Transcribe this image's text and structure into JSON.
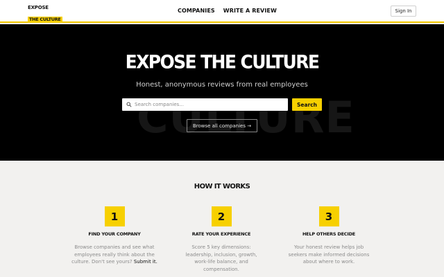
{
  "header": {
    "logo_line1": "EXPOSE",
    "logo_line2": "THE CULTURE",
    "nav": [
      "COMPANIES",
      "WRITE A REVIEW"
    ],
    "signin_label": "Sign In"
  },
  "hero": {
    "title": "EXPOSE THE CULTURE",
    "subtitle": "Honest, anonymous reviews from real employees",
    "background_word": "CULTURE",
    "search_placeholder": "Search companies...",
    "search_button": "Search",
    "browse_button": "Browse all companies →"
  },
  "how_it_works": {
    "title": "HOW IT WORKS",
    "steps": [
      {
        "number": "1",
        "title": "FIND YOUR COMPANY",
        "description": "Browse companies and see what employees really think about the culture. Don't see yours?",
        "link_text": "Submit it."
      },
      {
        "number": "2",
        "title": "RATE YOUR EXPERIENCE",
        "description": "Score 5 key dimensions: leadership, inclusion, growth, work-life balance, and compensation."
      },
      {
        "number": "3",
        "title": "HELP OTHERS DECIDE",
        "description": "Your honest review helps job seekers make informed decisions about where to work."
      }
    ]
  },
  "colors": {
    "accent": "#f7d000",
    "hero_background": "#000000",
    "section_background": "#f2f1ef"
  },
  "icons": {
    "search": "search-icon"
  }
}
